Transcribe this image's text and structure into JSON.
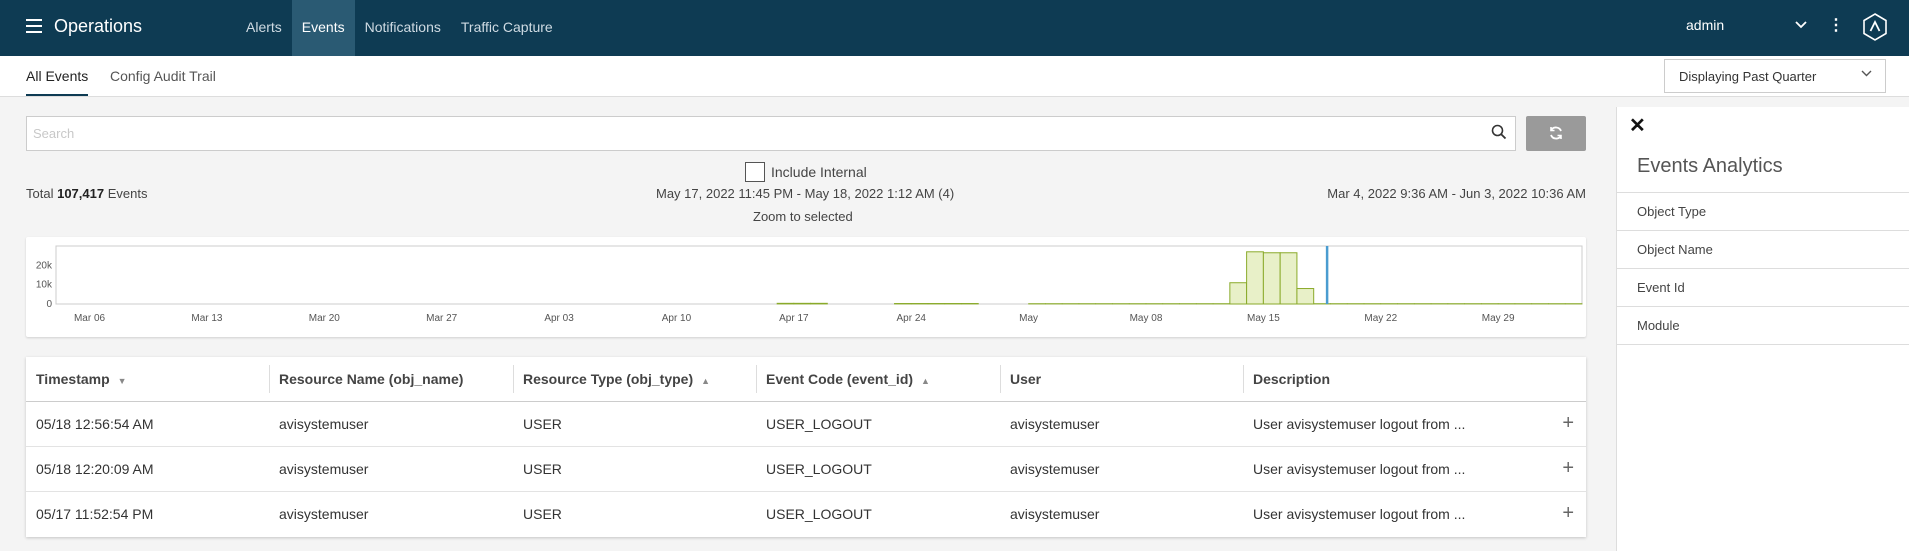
{
  "app": {
    "title": "Operations",
    "menu_icon": "hamburger-icon",
    "logo_icon": "avi-logo-icon"
  },
  "nav": {
    "items": [
      {
        "label": "Alerts",
        "active": false
      },
      {
        "label": "Events",
        "active": true
      },
      {
        "label": "Notifications",
        "active": false
      },
      {
        "label": "Traffic Capture",
        "active": false
      }
    ]
  },
  "user": {
    "name": "admin"
  },
  "subtabs": [
    {
      "label": "All Events",
      "active": true
    },
    {
      "label": "Config Audit Trail",
      "active": false
    }
  ],
  "time_range": {
    "selected": "Displaying Past Quarter"
  },
  "search": {
    "placeholder": "Search",
    "value": ""
  },
  "filters": {
    "include_internal_label": "Include Internal",
    "include_internal_checked": false
  },
  "summary": {
    "total_prefix": "Total",
    "total_count": "107,417",
    "total_suffix": "Events",
    "selected_range": "May 17, 2022 11:45 PM - May 18, 2022 1:12 AM (4)",
    "zoom_label": "Zoom to selected",
    "full_range": "Mar 4, 2022 9:36 AM - Jun 3, 2022 10:36 AM"
  },
  "chart_data": {
    "type": "bar",
    "ylim": [
      0,
      30000
    ],
    "y_ticks": [
      "20k",
      "10k",
      "0"
    ],
    "x_ticks": [
      "Mar 06",
      "Mar 13",
      "Mar 20",
      "Mar 27",
      "Apr 03",
      "Apr 10",
      "Apr 17",
      "Apr 24",
      "May",
      "May 08",
      "May 15",
      "May 22",
      "May 29"
    ],
    "start_date": "Mar 04",
    "days": 91,
    "values": [
      0,
      0,
      0,
      0,
      0,
      0,
      0,
      0,
      0,
      0,
      0,
      0,
      0,
      0,
      0,
      0,
      0,
      0,
      0,
      0,
      0,
      0,
      0,
      0,
      0,
      0,
      0,
      0,
      0,
      0,
      0,
      0,
      0,
      0,
      0,
      0,
      0,
      0,
      0,
      0,
      0,
      0,
      0,
      400,
      400,
      400,
      0,
      0,
      0,
      0,
      300,
      300,
      300,
      300,
      300,
      0,
      0,
      0,
      200,
      200,
      200,
      200,
      200,
      200,
      200,
      200,
      200,
      200,
      200,
      200,
      200,
      200,
      200,
      200,
      200,
      200,
      200,
      200,
      200,
      200,
      200,
      200,
      200,
      200,
      200,
      200,
      200,
      200,
      200,
      200,
      200,
      200,
      200,
      200,
      200,
      200,
      200,
      200,
      200,
      200,
      200,
      200,
      200,
      200,
      200,
      200,
      200,
      200,
      200,
      200,
      200,
      200,
      200,
      200
    ],
    "spike": [
      {
        "date": "May 13",
        "value": 11000
      },
      {
        "date": "May 14",
        "value": 27000
      },
      {
        "date": "May 15",
        "value": 26500
      },
      {
        "date": "May 16",
        "value": 26500
      },
      {
        "date": "May 17",
        "value": 8000
      }
    ],
    "selection_date": "May 18",
    "bar_color": "#e8f0c8",
    "bar_stroke": "#8aaa2a",
    "selection_color": "#4a9cd0"
  },
  "table": {
    "columns": [
      {
        "label": "Timestamp",
        "sort": "desc"
      },
      {
        "label": "Resource Name (obj_name)",
        "sort": "none"
      },
      {
        "label": "Resource Type (obj_type)",
        "sort": "both"
      },
      {
        "label": "Event Code (event_id)",
        "sort": "both"
      },
      {
        "label": "User",
        "sort": "none"
      },
      {
        "label": "Description",
        "sort": "none"
      }
    ],
    "rows": [
      [
        "05/18 12:56:54 AM",
        "avisystemuser",
        "USER",
        "USER_LOGOUT",
        "avisystemuser",
        "User avisystemuser logout from ..."
      ],
      [
        "05/18 12:20:09 AM",
        "avisystemuser",
        "USER",
        "USER_LOGOUT",
        "avisystemuser",
        "User avisystemuser logout from ..."
      ],
      [
        "05/17 11:52:54 PM",
        "avisystemuser",
        "USER",
        "USER_LOGOUT",
        "avisystemuser",
        "User avisystemuser logout from ..."
      ]
    ]
  },
  "panel": {
    "close_icon": "close-icon",
    "title": "Events Analytics",
    "items": [
      "Object Type",
      "Object Name",
      "Event Id",
      "Module"
    ]
  }
}
